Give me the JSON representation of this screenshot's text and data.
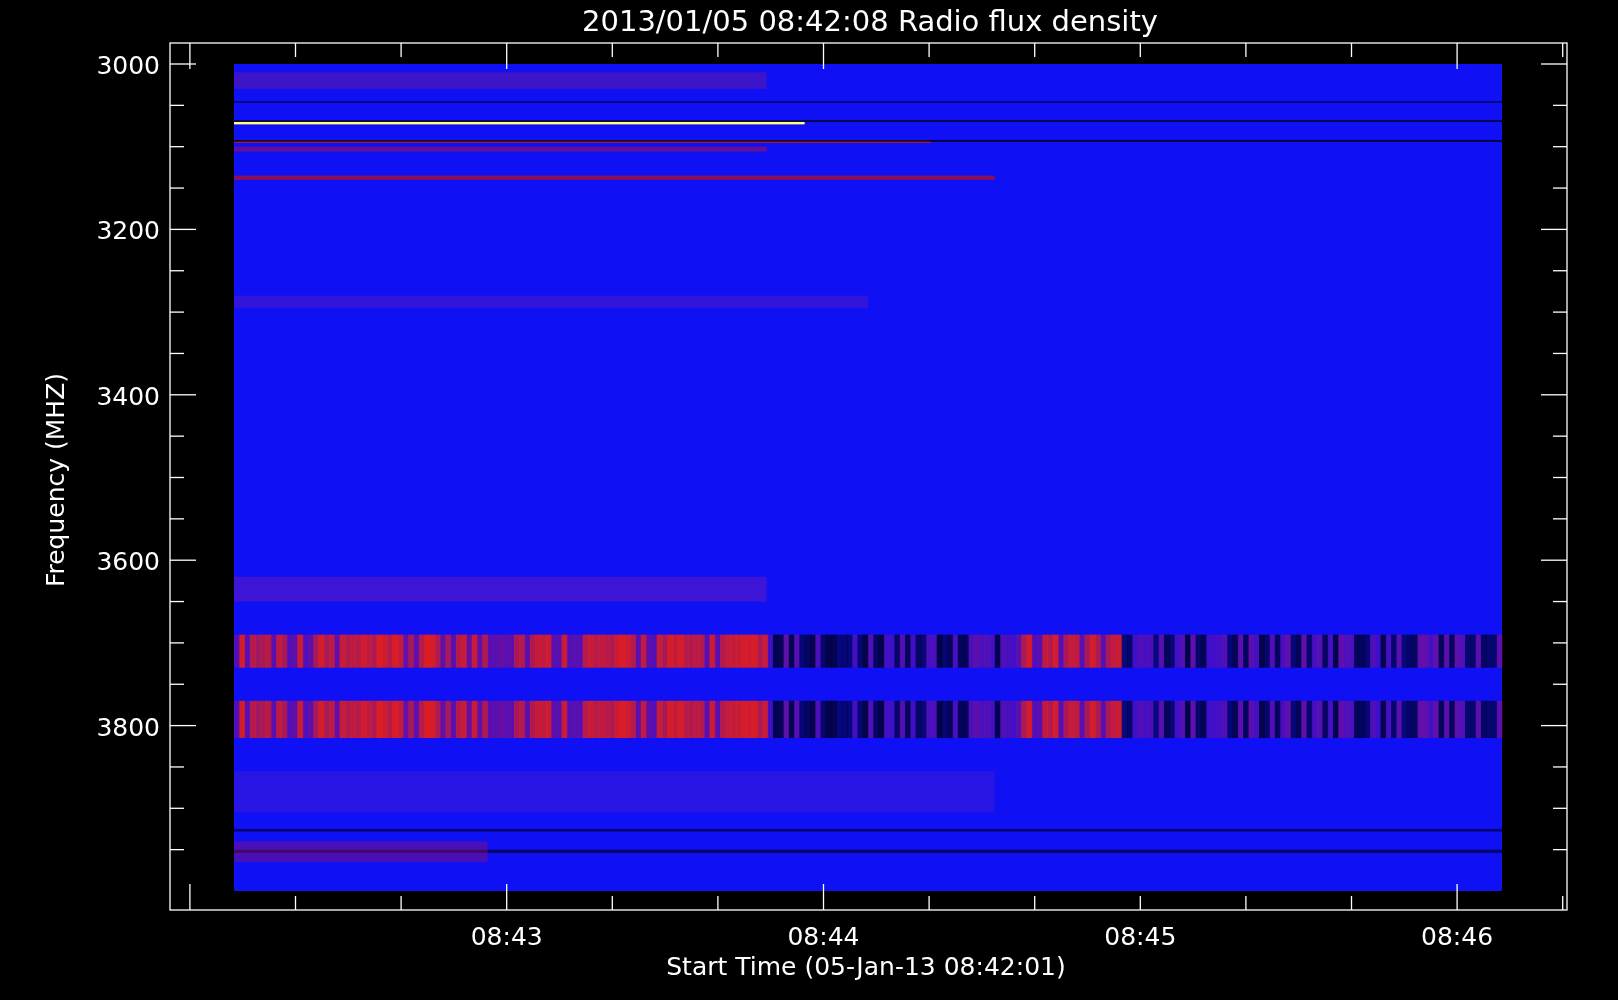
{
  "plot": {
    "title": "2013/01/05 08:42:08 Radio flux density",
    "y_axis": {
      "label": "Frequency (MHZ)",
      "ticks": [
        "3000",
        "3200",
        "3400",
        "3600",
        "3800"
      ]
    },
    "x_axis": {
      "label": "Start Time (05-Jan-13 08:42:01)",
      "ticks": [
        "08:43",
        "08:44",
        "08:45",
        "08:46"
      ]
    }
  }
}
